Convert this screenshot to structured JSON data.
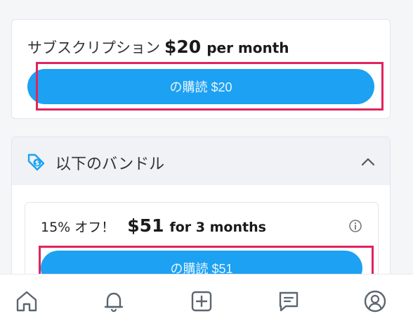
{
  "subscription": {
    "label": "サブスクリプション",
    "price": "$20",
    "period": "per month",
    "button_label": "の購読 $20"
  },
  "bundles": {
    "title": "以下のバンドル",
    "offer": {
      "discount": "15% オフ！",
      "price": "$51",
      "period": "for 3 months",
      "button_label": "の購読 $51"
    }
  },
  "colors": {
    "accent": "#1da1f2",
    "highlight": "#e0245e"
  },
  "icons": {
    "bundle": "price-tag-icon",
    "collapse": "chevron-up-icon",
    "info": "info-icon",
    "nav": [
      "home-icon",
      "bell-icon",
      "add-post-icon",
      "message-icon",
      "profile-icon"
    ]
  }
}
